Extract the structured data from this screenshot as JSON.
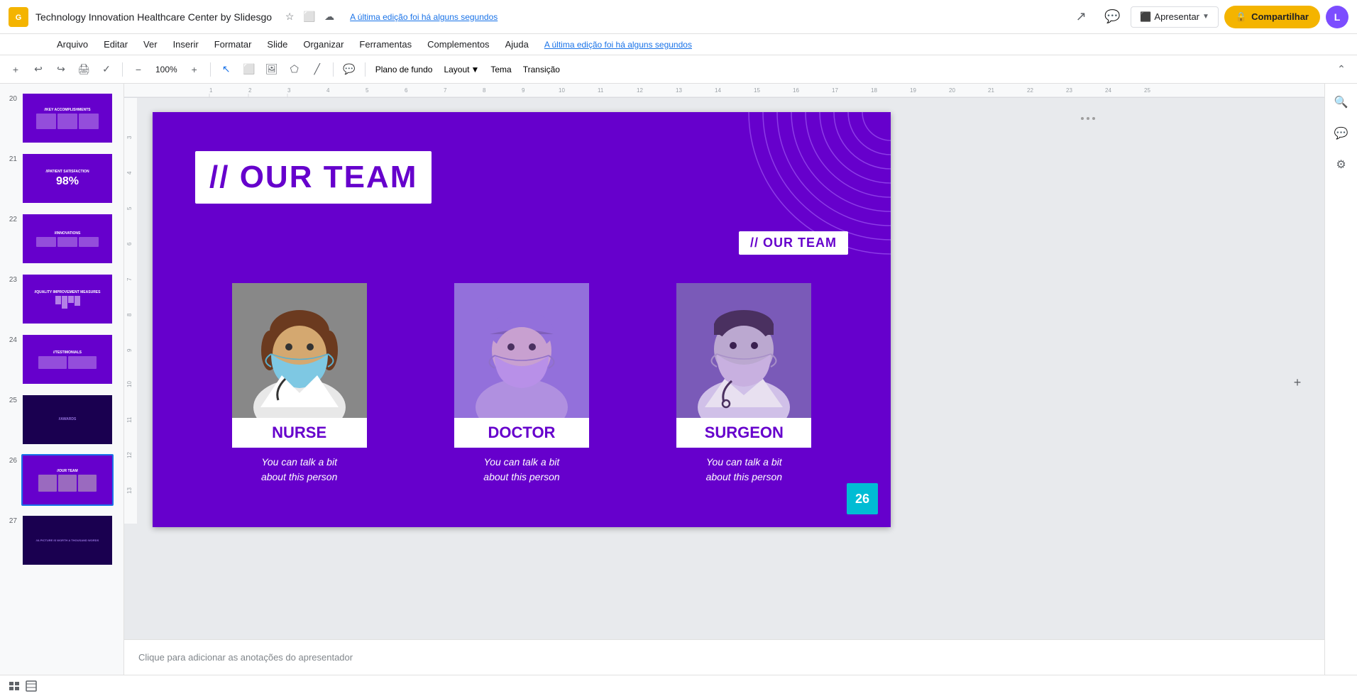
{
  "app": {
    "icon": "G",
    "title": "Technology Innovation Healthcare Center by Slidesgo",
    "save_status": "A última edição foi há alguns segundos",
    "avatar_initial": "L"
  },
  "topbar": {
    "buttons": {
      "apresentar": "Apresentar",
      "compartilhar": "🔒 Compartilhar"
    }
  },
  "menubar": {
    "items": [
      "Arquivo",
      "Editar",
      "Ver",
      "Inserir",
      "Formatar",
      "Slide",
      "Organizar",
      "Ferramentas",
      "Complementos",
      "Ajuda"
    ]
  },
  "toolbar": {
    "plano_fundo": "Plano de fundo",
    "layout": "Layout",
    "tema": "Tema",
    "transicao": "Transição"
  },
  "slide": {
    "title_prefix": "// ",
    "title": "OUR TEAM",
    "top_right_prefix": "// ",
    "top_right_label": "OUR TEAM",
    "team_members": [
      {
        "name": "NURSE",
        "description": "You can talk a bit\nabout this person"
      },
      {
        "name": "DOCTOR",
        "description": "You can talk a bit\nabout this person"
      },
      {
        "name": "SURGEON",
        "description": "You can talk a bit\nabout this person"
      }
    ],
    "page_number": "26"
  },
  "notes": {
    "placeholder": "Clique para adicionar as anotações do apresentador"
  },
  "sidebar": {
    "slide_numbers": [
      "20",
      "21",
      "22",
      "23",
      "24",
      "25",
      "26",
      "27"
    ]
  }
}
